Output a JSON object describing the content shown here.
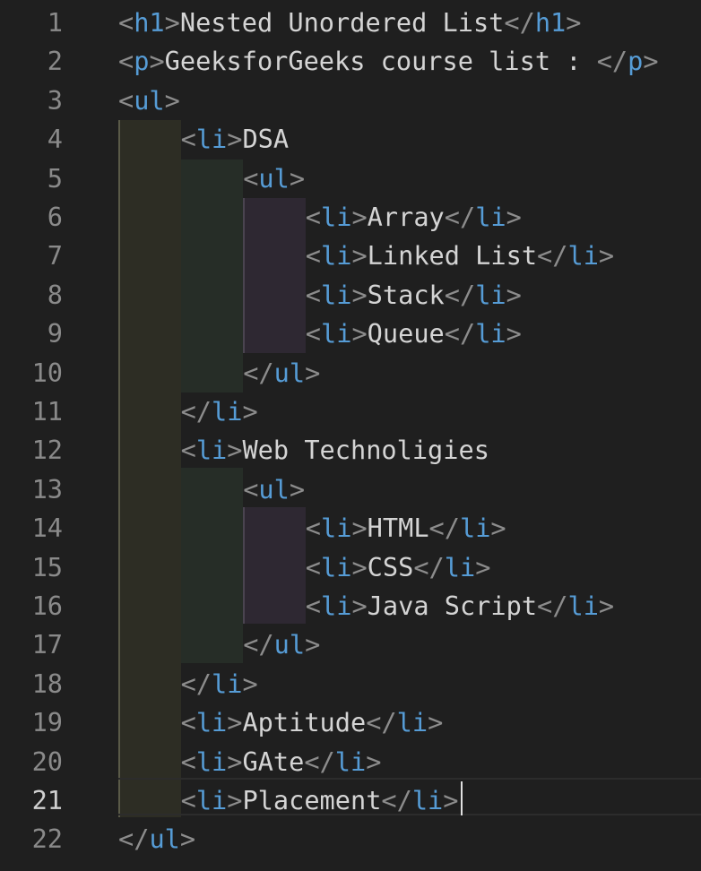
{
  "editor": {
    "active_line": 21,
    "lines": [
      {
        "number": "1",
        "indent": 0,
        "tokens": [
          {
            "t": "br",
            "v": "<"
          },
          {
            "t": "tg",
            "v": "h1"
          },
          {
            "t": "br",
            "v": ">"
          },
          {
            "t": "tx",
            "v": "Nested Unordered List"
          },
          {
            "t": "br",
            "v": "</"
          },
          {
            "t": "tg",
            "v": "h1"
          },
          {
            "t": "br",
            "v": ">"
          }
        ]
      },
      {
        "number": "2",
        "indent": 0,
        "tokens": [
          {
            "t": "br",
            "v": "<"
          },
          {
            "t": "tg",
            "v": "p"
          },
          {
            "t": "br",
            "v": ">"
          },
          {
            "t": "tx",
            "v": "GeeksforGeeks course list : "
          },
          {
            "t": "br",
            "v": "</"
          },
          {
            "t": "tg",
            "v": "p"
          },
          {
            "t": "br",
            "v": ">"
          }
        ]
      },
      {
        "number": "3",
        "indent": 0,
        "tokens": [
          {
            "t": "br",
            "v": "<"
          },
          {
            "t": "tg",
            "v": "ul"
          },
          {
            "t": "br",
            "v": ">"
          }
        ]
      },
      {
        "number": "4",
        "indent": 1,
        "tokens": [
          {
            "t": "br",
            "v": "<"
          },
          {
            "t": "tg",
            "v": "li"
          },
          {
            "t": "br",
            "v": ">"
          },
          {
            "t": "tx",
            "v": "DSA"
          }
        ]
      },
      {
        "number": "5",
        "indent": 2,
        "tokens": [
          {
            "t": "br",
            "v": "<"
          },
          {
            "t": "tg",
            "v": "ul"
          },
          {
            "t": "br",
            "v": ">"
          }
        ]
      },
      {
        "number": "6",
        "indent": 3,
        "tokens": [
          {
            "t": "br",
            "v": "<"
          },
          {
            "t": "tg",
            "v": "li"
          },
          {
            "t": "br",
            "v": ">"
          },
          {
            "t": "tx",
            "v": "Array"
          },
          {
            "t": "br",
            "v": "</"
          },
          {
            "t": "tg",
            "v": "li"
          },
          {
            "t": "br",
            "v": ">"
          }
        ]
      },
      {
        "number": "7",
        "indent": 3,
        "tokens": [
          {
            "t": "br",
            "v": "<"
          },
          {
            "t": "tg",
            "v": "li"
          },
          {
            "t": "br",
            "v": ">"
          },
          {
            "t": "tx",
            "v": "Linked List"
          },
          {
            "t": "br",
            "v": "</"
          },
          {
            "t": "tg",
            "v": "li"
          },
          {
            "t": "br",
            "v": ">"
          }
        ]
      },
      {
        "number": "8",
        "indent": 3,
        "tokens": [
          {
            "t": "br",
            "v": "<"
          },
          {
            "t": "tg",
            "v": "li"
          },
          {
            "t": "br",
            "v": ">"
          },
          {
            "t": "tx",
            "v": "Stack"
          },
          {
            "t": "br",
            "v": "</"
          },
          {
            "t": "tg",
            "v": "li"
          },
          {
            "t": "br",
            "v": ">"
          }
        ]
      },
      {
        "number": "9",
        "indent": 3,
        "tokens": [
          {
            "t": "br",
            "v": "<"
          },
          {
            "t": "tg",
            "v": "li"
          },
          {
            "t": "br",
            "v": ">"
          },
          {
            "t": "tx",
            "v": "Queue"
          },
          {
            "t": "br",
            "v": "</"
          },
          {
            "t": "tg",
            "v": "li"
          },
          {
            "t": "br",
            "v": ">"
          }
        ]
      },
      {
        "number": "10",
        "indent": 2,
        "tokens": [
          {
            "t": "br",
            "v": "</"
          },
          {
            "t": "tg",
            "v": "ul"
          },
          {
            "t": "br",
            "v": ">"
          }
        ]
      },
      {
        "number": "11",
        "indent": 1,
        "tokens": [
          {
            "t": "br",
            "v": "</"
          },
          {
            "t": "tg",
            "v": "li"
          },
          {
            "t": "br",
            "v": ">"
          }
        ]
      },
      {
        "number": "12",
        "indent": 1,
        "tokens": [
          {
            "t": "br",
            "v": "<"
          },
          {
            "t": "tg",
            "v": "li"
          },
          {
            "t": "br",
            "v": ">"
          },
          {
            "t": "tx",
            "v": "Web Technoligies"
          }
        ]
      },
      {
        "number": "13",
        "indent": 2,
        "tokens": [
          {
            "t": "br",
            "v": "<"
          },
          {
            "t": "tg",
            "v": "ul"
          },
          {
            "t": "br",
            "v": ">"
          }
        ]
      },
      {
        "number": "14",
        "indent": 3,
        "tokens": [
          {
            "t": "br",
            "v": "<"
          },
          {
            "t": "tg",
            "v": "li"
          },
          {
            "t": "br",
            "v": ">"
          },
          {
            "t": "tx",
            "v": "HTML"
          },
          {
            "t": "br",
            "v": "</"
          },
          {
            "t": "tg",
            "v": "li"
          },
          {
            "t": "br",
            "v": ">"
          }
        ]
      },
      {
        "number": "15",
        "indent": 3,
        "tokens": [
          {
            "t": "br",
            "v": "<"
          },
          {
            "t": "tg",
            "v": "li"
          },
          {
            "t": "br",
            "v": ">"
          },
          {
            "t": "tx",
            "v": "CSS"
          },
          {
            "t": "br",
            "v": "</"
          },
          {
            "t": "tg",
            "v": "li"
          },
          {
            "t": "br",
            "v": ">"
          }
        ]
      },
      {
        "number": "16",
        "indent": 3,
        "tokens": [
          {
            "t": "br",
            "v": "<"
          },
          {
            "t": "tg",
            "v": "li"
          },
          {
            "t": "br",
            "v": ">"
          },
          {
            "t": "tx",
            "v": "Java Script"
          },
          {
            "t": "br",
            "v": "</"
          },
          {
            "t": "tg",
            "v": "li"
          },
          {
            "t": "br",
            "v": ">"
          }
        ]
      },
      {
        "number": "17",
        "indent": 2,
        "tokens": [
          {
            "t": "br",
            "v": "</"
          },
          {
            "t": "tg",
            "v": "ul"
          },
          {
            "t": "br",
            "v": ">"
          }
        ]
      },
      {
        "number": "18",
        "indent": 1,
        "tokens": [
          {
            "t": "br",
            "v": "</"
          },
          {
            "t": "tg",
            "v": "li"
          },
          {
            "t": "br",
            "v": ">"
          }
        ]
      },
      {
        "number": "19",
        "indent": 1,
        "tokens": [
          {
            "t": "br",
            "v": "<"
          },
          {
            "t": "tg",
            "v": "li"
          },
          {
            "t": "br",
            "v": ">"
          },
          {
            "t": "tx",
            "v": "Aptitude"
          },
          {
            "t": "br",
            "v": "</"
          },
          {
            "t": "tg",
            "v": "li"
          },
          {
            "t": "br",
            "v": ">"
          }
        ]
      },
      {
        "number": "20",
        "indent": 1,
        "tokens": [
          {
            "t": "br",
            "v": "<"
          },
          {
            "t": "tg",
            "v": "li"
          },
          {
            "t": "br",
            "v": ">"
          },
          {
            "t": "tx",
            "v": "GAte"
          },
          {
            "t": "br",
            "v": "</"
          },
          {
            "t": "tg",
            "v": "li"
          },
          {
            "t": "br",
            "v": ">"
          }
        ]
      },
      {
        "number": "21",
        "indent": 1,
        "tokens": [
          {
            "t": "br",
            "v": "<"
          },
          {
            "t": "tg",
            "v": "li"
          },
          {
            "t": "br",
            "v": ">"
          },
          {
            "t": "tx",
            "v": "Placement"
          },
          {
            "t": "br",
            "v": "</"
          },
          {
            "t": "tg",
            "v": "li"
          },
          {
            "t": "br",
            "v": ">"
          }
        ]
      },
      {
        "number": "22",
        "indent": 0,
        "tokens": [
          {
            "t": "br",
            "v": "</"
          },
          {
            "t": "tg",
            "v": "ul"
          },
          {
            "t": "br",
            "v": ">"
          }
        ]
      }
    ]
  },
  "colors": {
    "background": "#1f1f1f",
    "tag": "#569cd6",
    "bracket": "#8c8c8c",
    "text": "#d4d4d4",
    "line_number": "#8a8a8a",
    "indent_band_1": "#2d2d24",
    "indent_band_2": "#262d27",
    "indent_band_3": "#2e2832"
  }
}
